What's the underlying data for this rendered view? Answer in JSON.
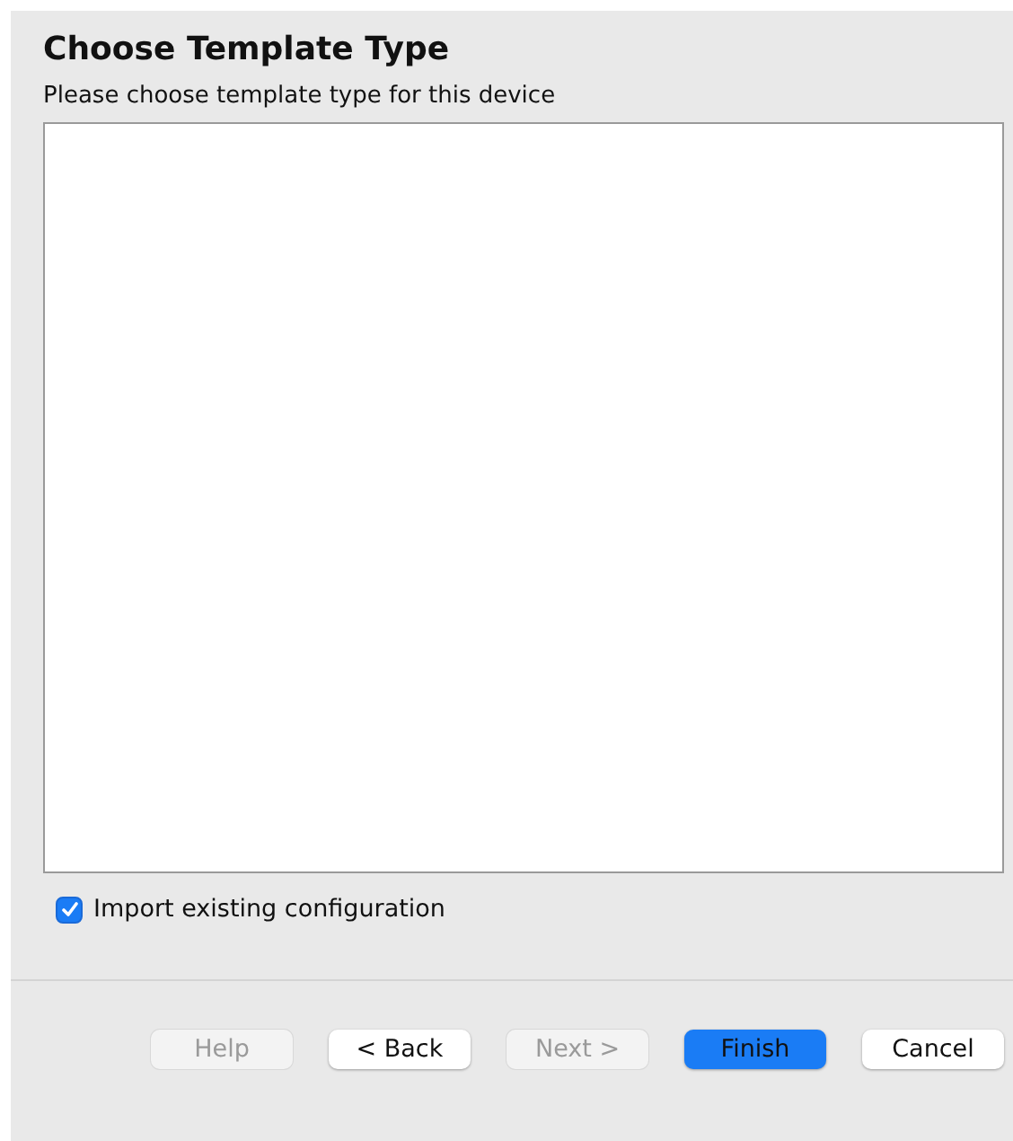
{
  "title": "Choose Template Type",
  "subtitle": "Please choose template type for this device",
  "import_checkbox": {
    "label": "Import existing configuration",
    "checked": true
  },
  "buttons": [
    {
      "label": "Help",
      "disabled": true,
      "default": false
    },
    {
      "label": "< Back",
      "disabled": false,
      "default": false
    },
    {
      "label": "Next >",
      "disabled": true,
      "default": false
    },
    {
      "label": "Finish",
      "disabled": false,
      "default": true
    },
    {
      "label": "Cancel",
      "disabled": false,
      "default": false
    }
  ]
}
